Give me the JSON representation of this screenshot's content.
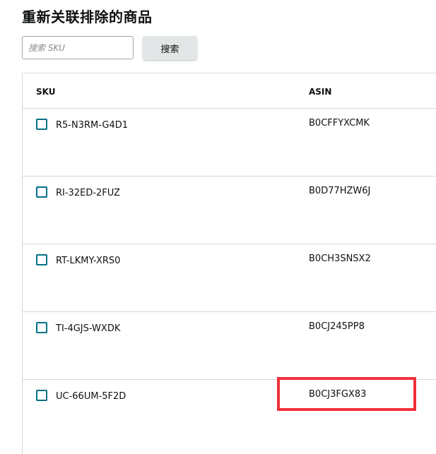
{
  "page_title": "重新关联排除的商品",
  "search": {
    "placeholder": "搜索 SKU",
    "value": "",
    "button_label": "搜索"
  },
  "table": {
    "columns": [
      "SKU",
      "ASIN"
    ],
    "rows": [
      {
        "sku": "R5-N3RM-G4D1",
        "asin": "B0CFFYXCMK"
      },
      {
        "sku": "RI-32ED-2FUZ",
        "asin": "B0D77HZW6J"
      },
      {
        "sku": "RT-LKMY-XRS0",
        "asin": "B0CH3SNSX2"
      },
      {
        "sku": "TI-4GJS-WXDK",
        "asin": "B0CJ245PP8"
      },
      {
        "sku": "UC-66UM-5F2D",
        "asin": "B0CJ3FGX83"
      }
    ]
  },
  "colors": {
    "checkbox_border": "#007185",
    "highlight_border": "#f0303a",
    "button_bg": "#e3e6e6",
    "divider": "#d5d9d9"
  }
}
